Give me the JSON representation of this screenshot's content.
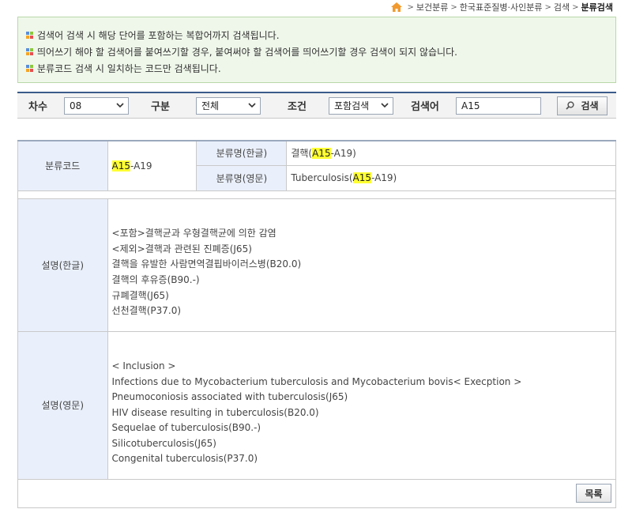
{
  "breadcrumb": {
    "items": [
      "보건분류",
      "한국표준질병·사인분류",
      "검색"
    ],
    "current": "분류검색"
  },
  "notice": {
    "lines": [
      "검색어 검색 시 해당 단어를 포함하는 복합어까지 검색됩니다.",
      "띄어쓰기 해야 할 검색어를 붙여쓰기할 경우, 붙여써야 할 검색어를 띄어쓰기할 경우 검색이 되지 않습니다.",
      "분류코드 검색 시 일치하는 코드만 검색됩니다."
    ]
  },
  "search": {
    "degree_label": "차수",
    "degree_value": "08",
    "type_label": "구분",
    "type_value": "전체",
    "condition_label": "조건",
    "condition_value": "포함검색",
    "keyword_label": "검색어",
    "keyword_value": "A15",
    "button_label": "검색"
  },
  "detail": {
    "code_label": "분류코드",
    "code_hl": "A15",
    "code_rest": "-A19",
    "name_kr_label": "분류명(한글)",
    "name_kr_prefix": "결핵(",
    "name_kr_hl": "A15",
    "name_kr_suffix": "-A19)",
    "name_en_label": "분류명(영문)",
    "name_en_prefix": "Tuberculosis(",
    "name_en_hl": "A15",
    "name_en_suffix": "-A19)",
    "desc_kr_label": "설명(한글)",
    "desc_kr_lines": [
      "<포함>결핵균과 우형결핵균에 의한 감염",
      "<제외>결핵과 관련된 진폐증(J65)",
      "결핵을 유발한 사람면역결핍바이러스병(B20.0)",
      "결핵의 후유증(B90.-)",
      "규폐결핵(J65)",
      "선천결핵(P37.0)"
    ],
    "desc_en_label": "설명(영문)",
    "desc_en_lines": [
      "< Inclusion >",
      "Infections due to Mycobacterium tuberculosis and Mycobacterium bovis< Execption >",
      "Pneumoconiosis associated with tuberculosis(J65)",
      "HIV disease resulting in tuberculosis(B20.0)",
      "Sequelae of tuberculosis(B90.-)",
      "Silicotuberculosis(J65)",
      "Congenital tuberculosis(P37.0)"
    ]
  },
  "list_button": "목록",
  "colors": {
    "header_border": "#3a5b8a",
    "label_blue": "#5878a8",
    "highlight": "#ffff33",
    "notice_bg": "#eff7ea"
  }
}
